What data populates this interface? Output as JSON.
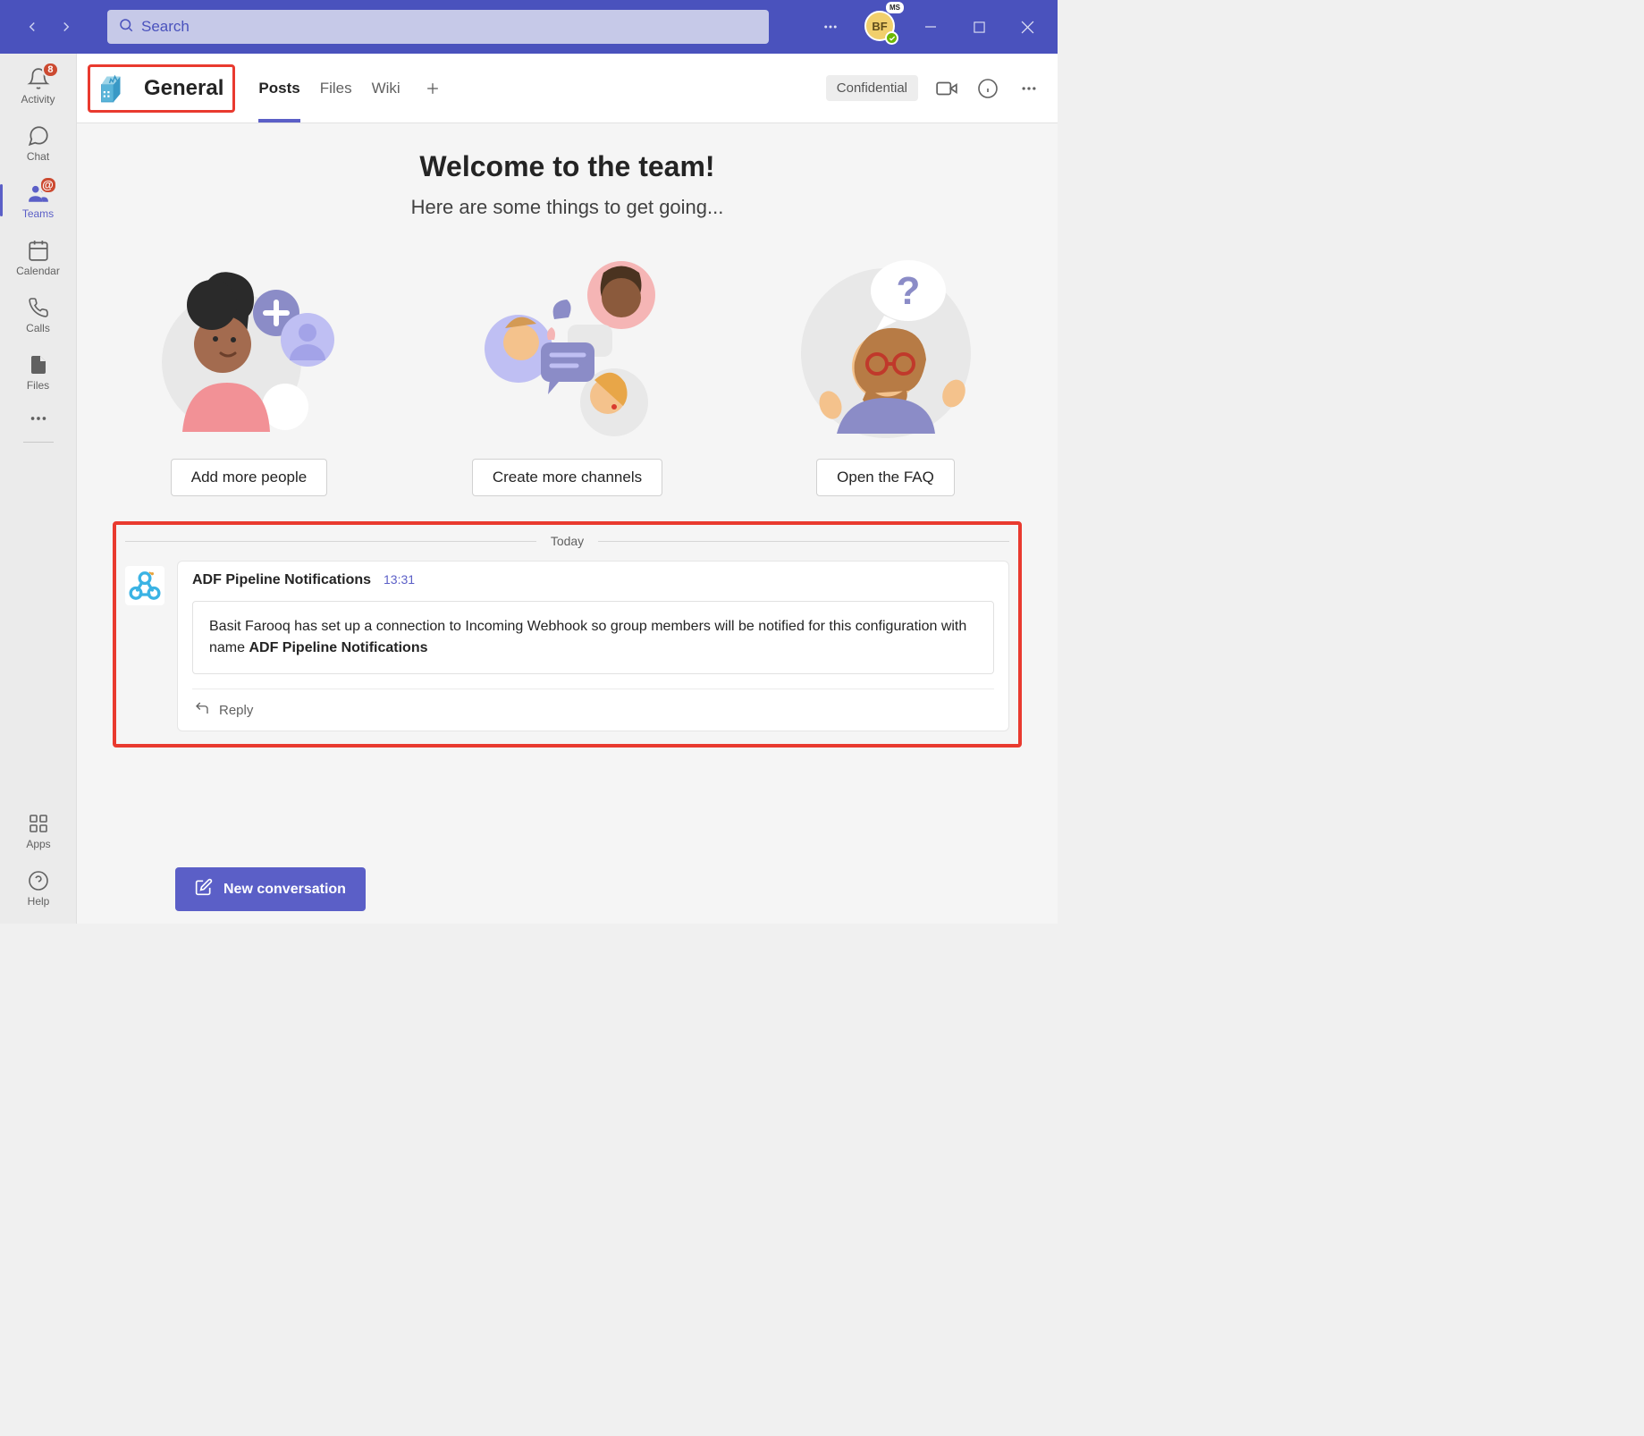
{
  "titlebar": {
    "search_placeholder": "Search",
    "avatar_initials": "BF",
    "avatar_badge": "MS"
  },
  "rail": {
    "items": [
      {
        "label": "Activity",
        "badge": "8"
      },
      {
        "label": "Chat"
      },
      {
        "label": "Teams",
        "mention": "@"
      },
      {
        "label": "Calendar"
      },
      {
        "label": "Calls"
      },
      {
        "label": "Files"
      }
    ],
    "apps_label": "Apps",
    "help_label": "Help"
  },
  "channel": {
    "name": "General",
    "tabs": [
      "Posts",
      "Files",
      "Wiki"
    ],
    "confidential_label": "Confidential"
  },
  "welcome": {
    "title": "Welcome to the team!",
    "subtitle": "Here are some things to get going...",
    "cards": [
      {
        "button": "Add more people"
      },
      {
        "button": "Create more channels"
      },
      {
        "button": "Open the FAQ"
      }
    ]
  },
  "thread": {
    "date_label": "Today",
    "sender": "ADF Pipeline Notifications",
    "time": "13:31",
    "body_prefix": "Basit Farooq has set up a connection to Incoming Webhook so group members will be notified for this configuration with name ",
    "body_bold": "ADF Pipeline Notifications",
    "reply_label": "Reply"
  },
  "compose": {
    "new_conversation_label": "New conversation"
  }
}
